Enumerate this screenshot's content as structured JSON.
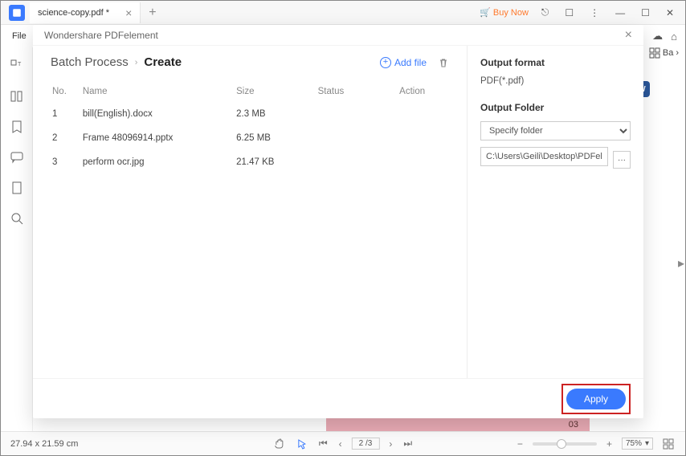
{
  "titlebar": {
    "tab_name": "science-copy.pdf *",
    "buy_now": "Buy Now"
  },
  "menubar": {
    "file": "File"
  },
  "right_ribbon": {
    "ba": "Ba"
  },
  "modal": {
    "title": "Wondershare PDFelement",
    "breadcrumb_root": "Batch Process",
    "breadcrumb_current": "Create",
    "add_file": "Add file",
    "table": {
      "headers": {
        "no": "No.",
        "name": "Name",
        "size": "Size",
        "status": "Status",
        "action": "Action"
      },
      "rows": [
        {
          "no": "1",
          "name": "bill(English).docx",
          "size": "2.3 MB",
          "status": "",
          "action": ""
        },
        {
          "no": "2",
          "name": "Frame 48096914.pptx",
          "size": "6.25 MB",
          "status": "",
          "action": ""
        },
        {
          "no": "3",
          "name": "perform ocr.jpg",
          "size": "21.47 KB",
          "status": "",
          "action": ""
        }
      ]
    },
    "right": {
      "output_format_label": "Output format",
      "output_format_value": "PDF(*.pdf)",
      "output_folder_label": "Output Folder",
      "specify_folder_placeholder": "Specify folder",
      "folder_path": "C:\\Users\\Geili\\Desktop\\PDFelement\\Cr"
    },
    "apply": "Apply"
  },
  "bg": {
    "pink_number": "03"
  },
  "statusbar": {
    "dim": "27.94 x 21.59 cm",
    "page": "2 /3",
    "zoom": "75%"
  }
}
